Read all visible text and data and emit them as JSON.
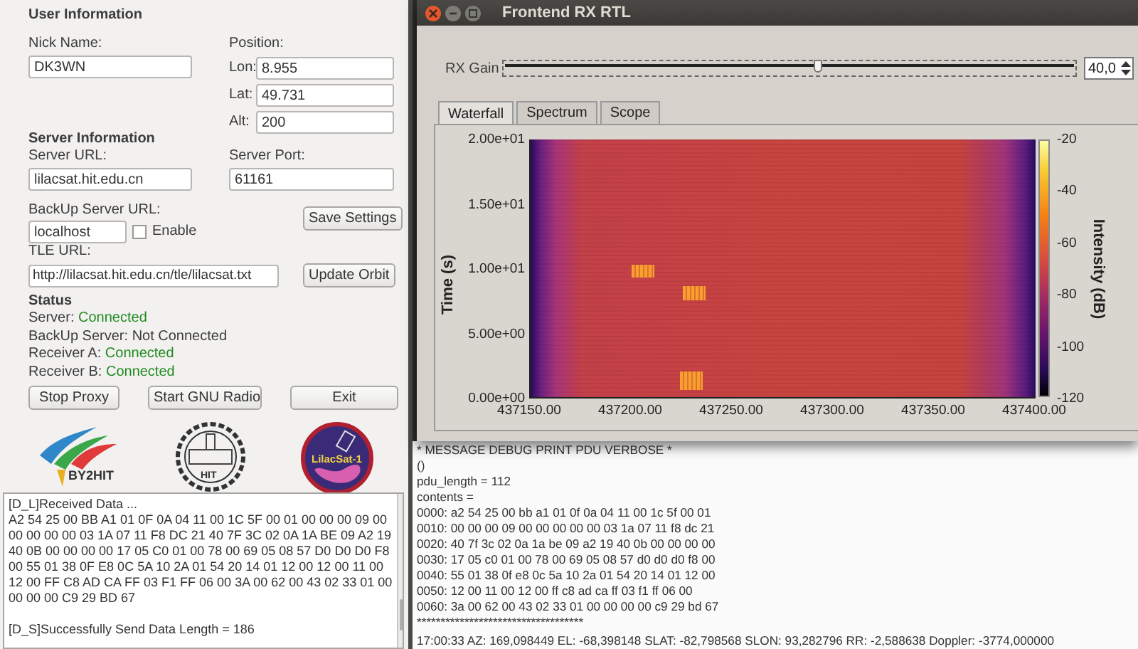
{
  "user_info": {
    "title": "User Information",
    "nick_label": "Nick Name:",
    "nick_value": "DK3WN",
    "position_label": "Position:",
    "position_fields": [
      {
        "label": "Lon:",
        "value": "8.955"
      },
      {
        "label": "Lat:",
        "value": "49.731"
      },
      {
        "label": "Alt:",
        "value": "200"
      }
    ]
  },
  "server_info": {
    "title": "Server Information",
    "url_label": "Server URL:",
    "url_value": "lilacsat.hit.edu.cn",
    "port_label": "Server Port:",
    "port_value": "61161",
    "backup_label": "BackUp Server URL:",
    "backup_value": "localhost",
    "enable": {
      "label": "Enable",
      "checked": false
    },
    "save_button": "Save Settings",
    "tle_label": "TLE URL:",
    "tle_value": "http://lilacsat.hit.edu.cn/tle/lilacsat.txt",
    "update_button": "Update Orbit"
  },
  "status": {
    "title": "Status",
    "items": [
      {
        "label": "Server:",
        "value": "Connected",
        "connected": true
      },
      {
        "label": "BackUp Server:",
        "value": "Not Connected",
        "connected": false
      },
      {
        "label": "Receiver A:",
        "value": "Connected",
        "connected": true
      },
      {
        "label": "Receiver B:",
        "value": "Connected",
        "connected": true
      }
    ]
  },
  "actions": [
    "Stop Proxy",
    "Start GNU Radio",
    "Exit"
  ],
  "logos": [
    {
      "kind": "club",
      "text": "BY2HIT"
    },
    {
      "kind": "university",
      "text": "HIT"
    },
    {
      "kind": "satellite",
      "text": "LilacSat-1"
    }
  ],
  "log": {
    "lines": [
      "[D_L]Received Data ...",
      "A2 54 25 00 BB A1 01 0F 0A 04 11 00 1C 5F 00 01 00 00 00 09 00",
      "00 00 00 00 03 1A 07 11 F8 DC 21 40 7F 3C 02 0A 1A BE 09 A2 19",
      "40 0B 00 00 00 00 17 05 C0 01 00 78 00 69 05 08 57 D0 D0 D0 F8",
      "00 55 01 38 0F E8 0C 5A 10 2A 01 54 20 14 01 12 00 12 00 11 00",
      "12 00 FF C8 AD CA FF 03 F1 FF 06 00 3A 00 62 00 43 02 33 01 00",
      "00 00 00 C9 29 BD 67",
      "[D_S]Successfully Send Data Length = 186"
    ]
  },
  "rx_window": {
    "title": "Frontend RX RTL",
    "gain": {
      "label": "RX Gain",
      "level": 0.55,
      "value": "40,0"
    },
    "tabs": [
      {
        "label": "Waterfall",
        "selected": true
      },
      {
        "label": "Spectrum",
        "selected": false
      },
      {
        "label": "Scope",
        "selected": false
      }
    ],
    "waterfall": {
      "ylabel": "Time (s)",
      "yticks": [
        "2.00e+01",
        "1.50e+01",
        "1.00e+01",
        "5.00e+00",
        "0.00e+00"
      ],
      "xticks": [
        "437150.00",
        "437200.00",
        "437250.00",
        "437300.00",
        "437350.00",
        "437400.00"
      ],
      "colorbar_label": "Intensity (dB)",
      "colorbar_ticks": [
        "-20",
        "-40",
        "-60",
        "-80",
        "-100",
        "-120"
      ]
    }
  },
  "terminal": {
    "lines": [
      "* MESSAGE DEBUG PRINT PDU VERBOSE *",
      "()",
      "pdu_length = 112",
      "contents = ",
      "0000: a2 54 25 00 bb a1 01 0f 0a 04 11 00 1c 5f 00 01",
      "0010: 00 00 00 09 00 00 00 00 00 03 1a 07 11 f8 dc 21",
      "0020: 40 7f 3c 02 0a 1a be 09 a2 19 40 0b 00 00 00 00",
      "0030: 17 05 c0 01 00 78 00 69 05 08 57 d0 d0 d0 f8 00",
      "0040: 55 01 38 0f e8 0c 5a 10 2a 01 54 20 14 01 12 00",
      "0050: 12 00 11 00 12 00 ff c8 ad ca ff 03 f1 ff 06 00",
      "0060: 3a 00 62 00 43 02 33 01 00 00 00 00 c9 29 bd 67",
      "***********************************",
      "17:00:33 AZ: 169,098449 EL: -68,398148 SLAT: -82,798568 SLON: 93,282796 RR: -2,588638 Doppler: -3774,000000"
    ]
  }
}
